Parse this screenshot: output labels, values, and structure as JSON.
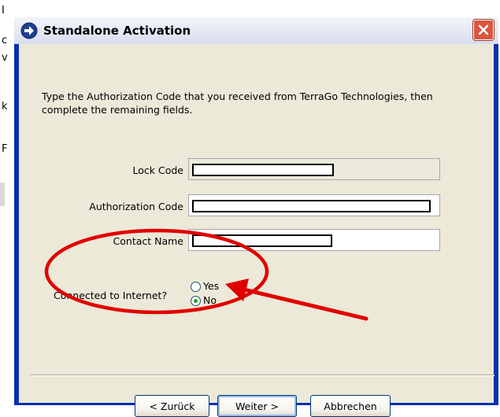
{
  "background": {
    "chars": [
      "I",
      "c",
      "v",
      "k",
      "F"
    ]
  },
  "dialog": {
    "title": "Standalone Activation",
    "instruction": "Type the Authorization Code that you received from TerraGo Technologies, then complete the remaining fields.",
    "fields": [
      {
        "label": "Lock Code",
        "editable": false
      },
      {
        "label": "Authorization Code",
        "editable": true
      },
      {
        "label": "Contact Name",
        "editable": true
      }
    ],
    "internet": {
      "label": "Connected to Internet?",
      "options": [
        {
          "label": "Yes",
          "selected": false
        },
        {
          "label": "No",
          "selected": true
        }
      ]
    },
    "buttons": {
      "back": "< Zurück",
      "next": "Weiter >",
      "cancel": "Abbrechen"
    }
  },
  "annotation": {
    "color": "#e00000"
  }
}
